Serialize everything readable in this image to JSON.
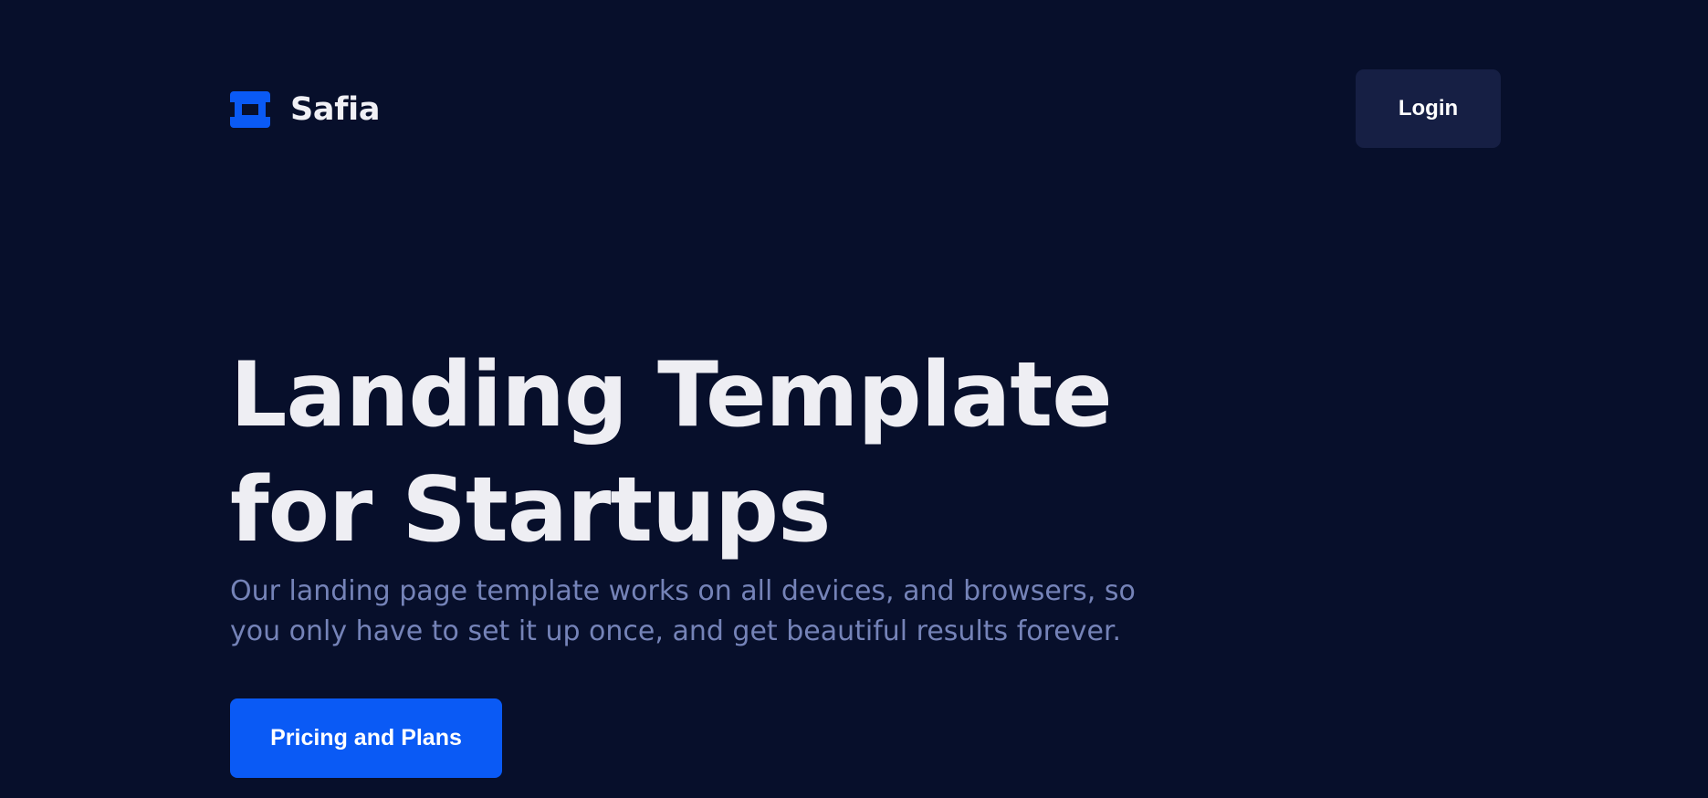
{
  "header": {
    "brand_name": "Safia",
    "login_label": "Login"
  },
  "hero": {
    "title_line1": "Landing Template",
    "title_line2": "for Startups",
    "subtitle": "Our landing page template works on all devices, and browsers, so you only have to set it up once, and get beautiful results forever.",
    "cta_label": "Pricing and Plans"
  },
  "colors": {
    "background": "#070f2b",
    "accent": "#0a5af5",
    "login_bg": "#161f44",
    "title_text": "#eeeef3",
    "subtitle_text": "#7583b8"
  },
  "icons": {
    "brand_logo": "ticket-logo-icon"
  }
}
